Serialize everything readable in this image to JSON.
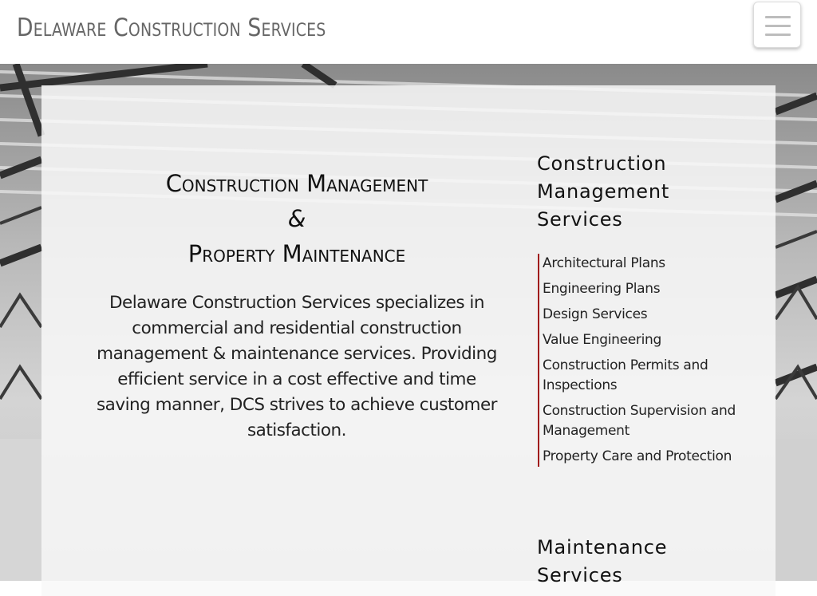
{
  "header": {
    "site_title": "Delaware Construction Services",
    "menu_icon": "hamburger-menu-icon"
  },
  "main": {
    "heading_line1": "Construction Management",
    "heading_line2": "&",
    "heading_line3": "Property Maintenance",
    "intro": "Delaware Construction Services specializes in commercial and residential construction management & maintenance services. Providing efficient service in a cost effective and time saving manner, DCS strives to achieve customer satisfaction."
  },
  "sidebar": {
    "construction_heading": "Construction Management Services",
    "services": [
      "Architectural Plans",
      "Engineering Plans",
      "Design Services",
      "Value Engineering",
      "Construction Permits and Inspections",
      "Construction Supervision and Management",
      "Property Care and Protection"
    ],
    "maintenance_heading": "Maintenance Services"
  },
  "colors": {
    "accent": "#a01c1c",
    "title_gray": "#666666",
    "panel": "#f8f8f8"
  }
}
